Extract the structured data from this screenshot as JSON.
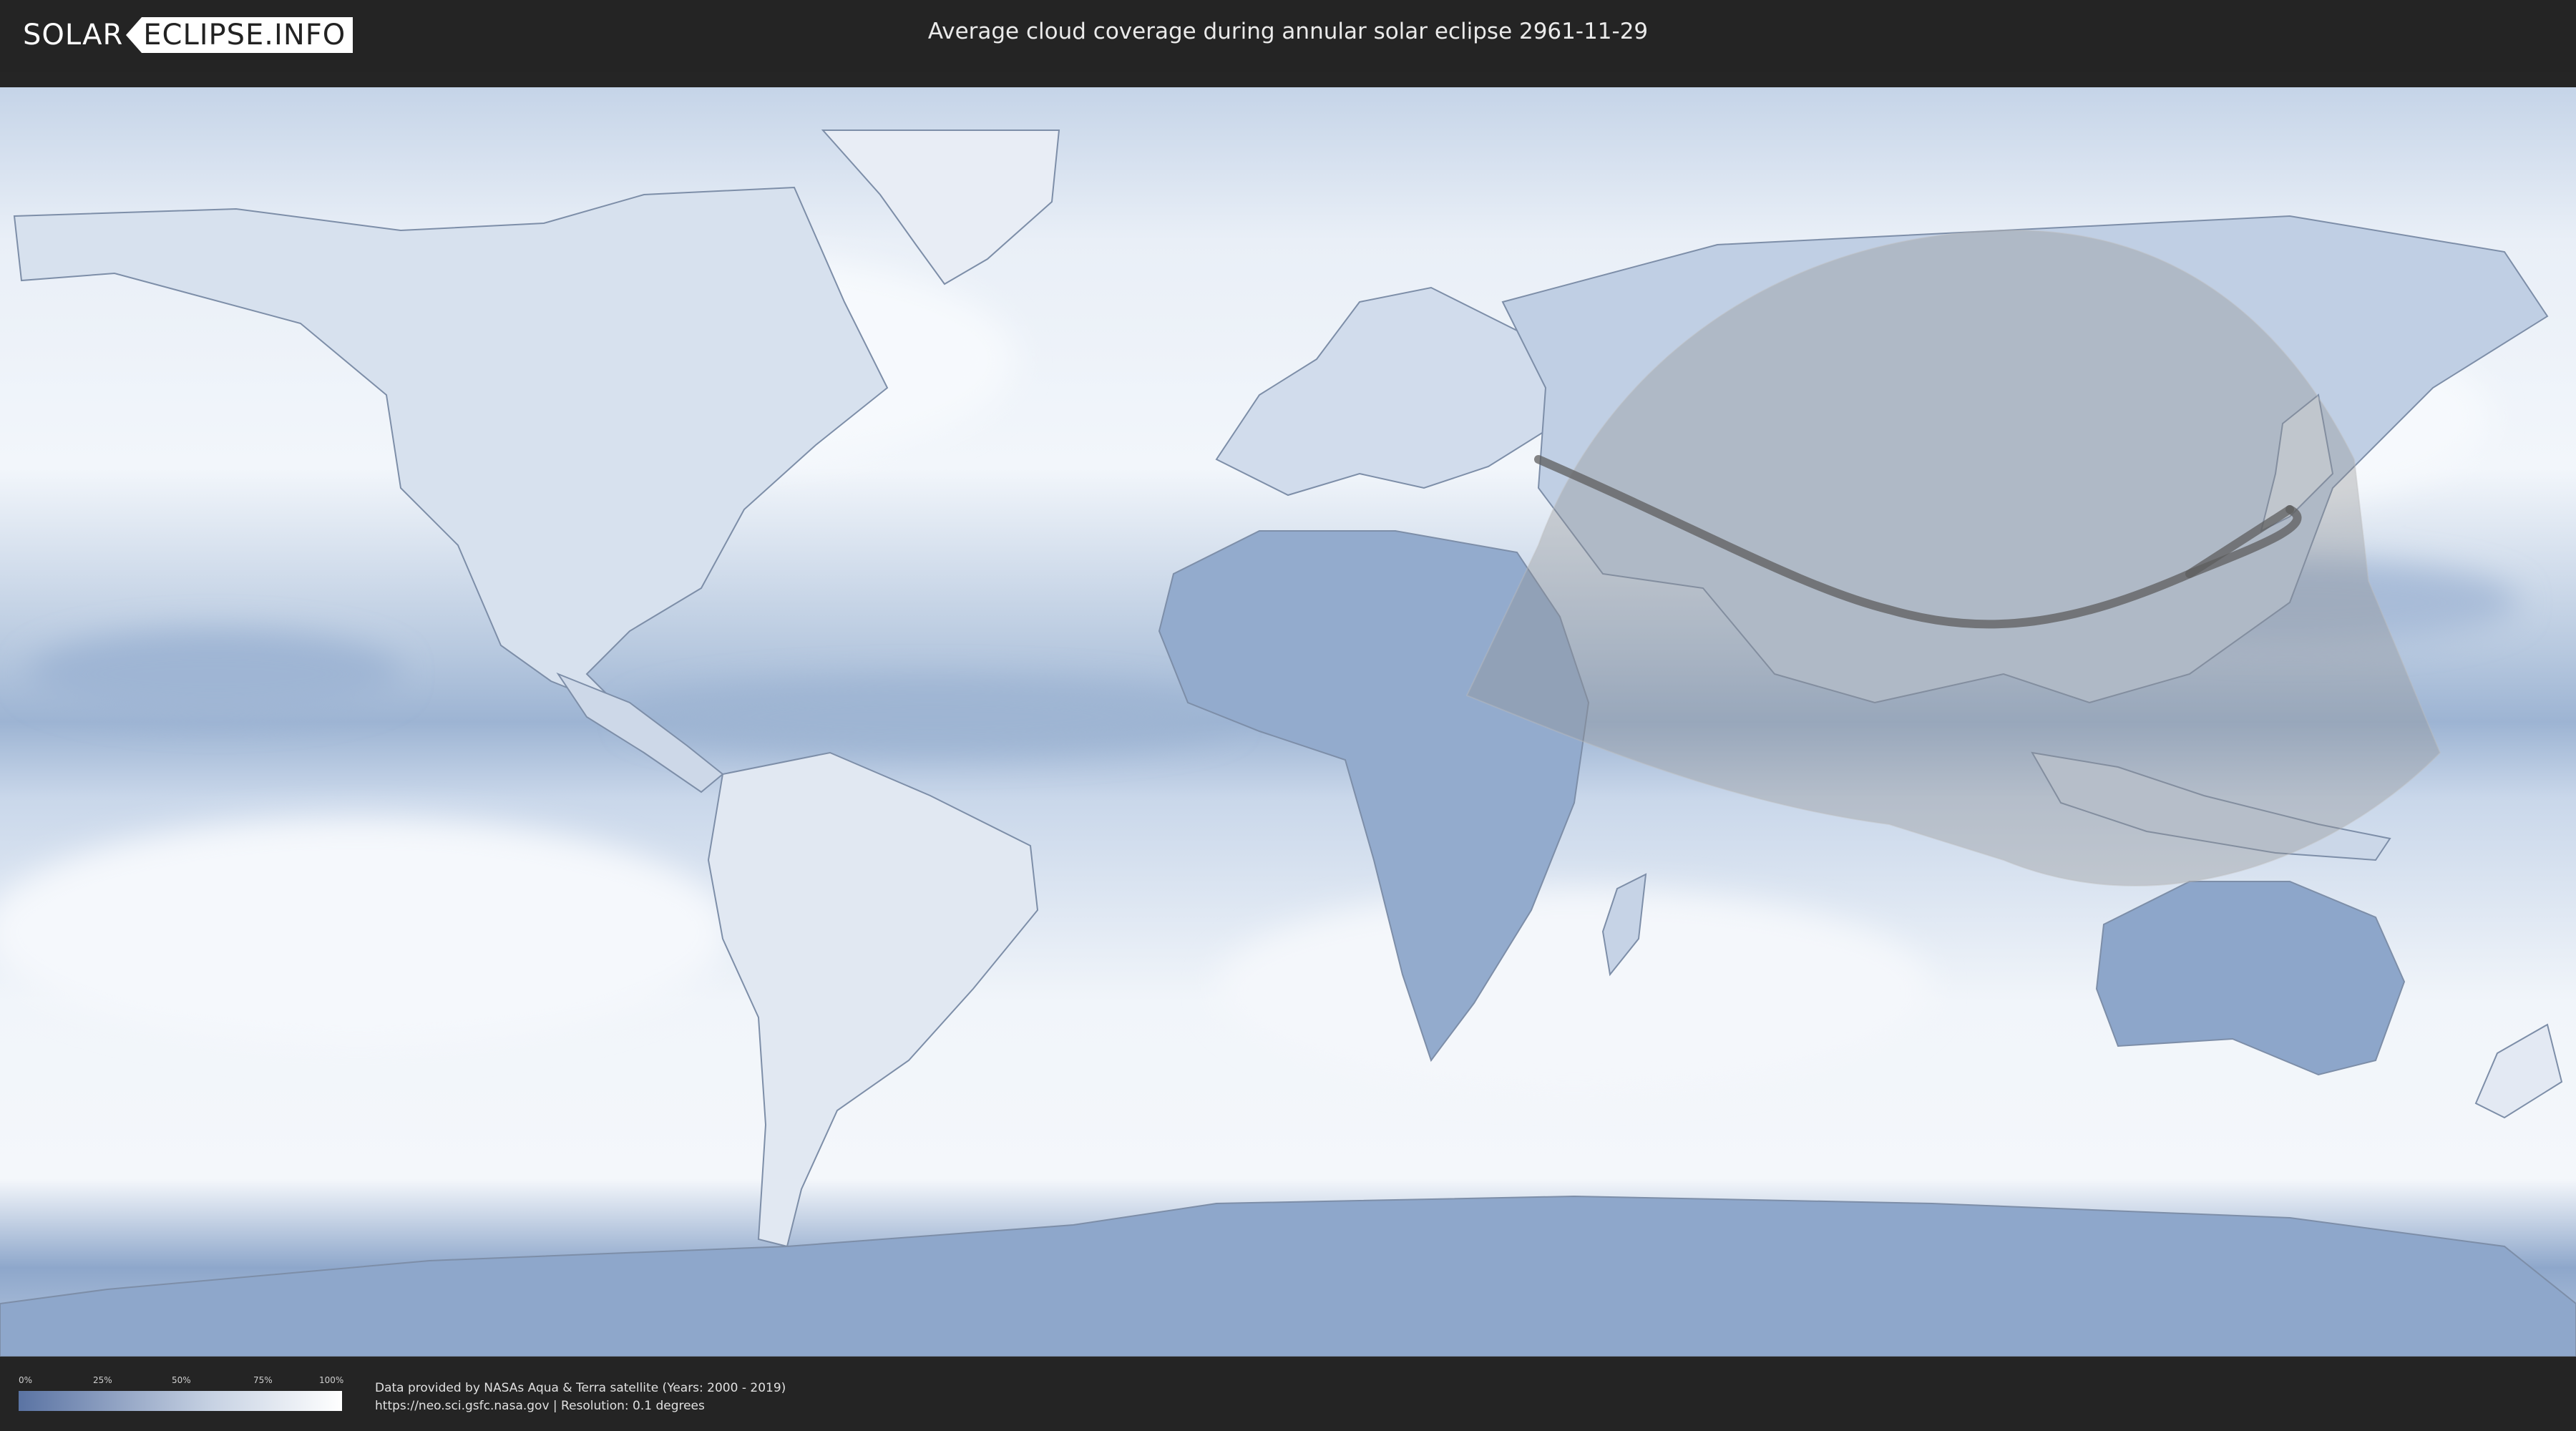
{
  "header": {
    "logo_left": "SOLAR",
    "logo_right": "ECLIPSE.INFO",
    "title": "Average cloud coverage during annular solar eclipse 2961-11-29"
  },
  "map": {
    "type": "equirectangular world cloud coverage map",
    "visibility_zone": "partial eclipse visibility region over Asia, Middle East, East Africa and Indian Ocean",
    "central_path": "annular eclipse path from Egypt/Arabia across India and Southeast Asia to the Philippines",
    "colors": {
      "ocean_clear": "#7f9bc4",
      "cloud": "#f3f6fb",
      "land": "#d6e0ee",
      "zone_overlay": "#9a9a9a",
      "path": "#5e5e5e"
    }
  },
  "legend": {
    "ticks": [
      "0%",
      "25%",
      "50%",
      "75%",
      "100%"
    ],
    "colors": {
      "low": "#5a73a3",
      "high": "#ffffff"
    }
  },
  "credits": {
    "line1": "Data provided by NASAs Aqua & Terra satellite (Years: 2000 - 2019)",
    "line2": "https://neo.sci.gsfc.nasa.gov | Resolution: 0.1 degrees"
  }
}
